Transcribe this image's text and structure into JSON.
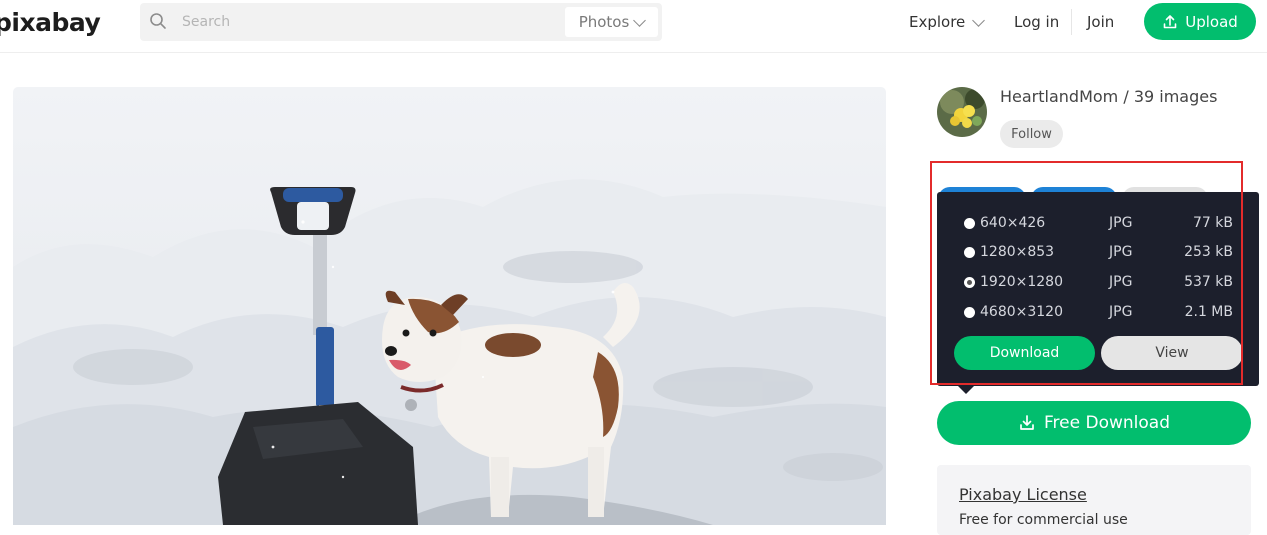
{
  "header": {
    "logo": "pixabay",
    "search": {
      "placeholder": "Search",
      "type_label": "Photos"
    },
    "nav": {
      "explore": "Explore",
      "login": "Log in",
      "join": "Join",
      "upload": "Upload"
    }
  },
  "author": {
    "name_line": "HeartlandMom / 39 images",
    "follow_label": "Follow"
  },
  "download_panel": {
    "sizes": [
      {
        "resolution": "640×426",
        "format": "JPG",
        "size": "77 kB",
        "selected": false
      },
      {
        "resolution": "1280×853",
        "format": "JPG",
        "size": "253 kB",
        "selected": false
      },
      {
        "resolution": "1920×1280",
        "format": "JPG",
        "size": "537 kB",
        "selected": true
      },
      {
        "resolution": "4680×3120",
        "format": "JPG",
        "size": "2.1 MB",
        "selected": false
      }
    ],
    "download_label": "Download",
    "view_label": "View"
  },
  "free_download_label": "Free Download",
  "license": {
    "title": "Pixabay License",
    "subtitle": "Free for commercial use"
  },
  "colors": {
    "accent_green": "#02be6e",
    "panel_bg": "#1c1f2c",
    "highlight_red": "#e32b2b",
    "tab_blue": "#1e82d6"
  },
  "icons": [
    "search-icon",
    "chevron-down-icon",
    "upload-icon",
    "download-icon"
  ]
}
